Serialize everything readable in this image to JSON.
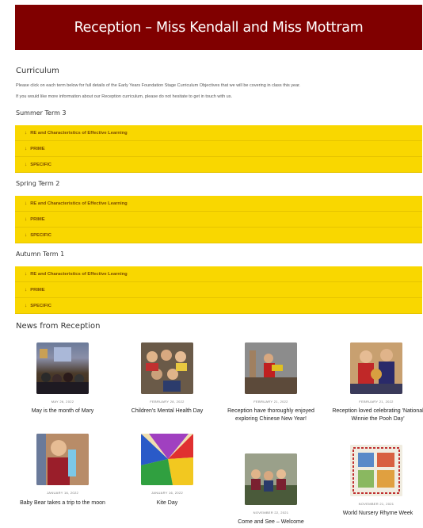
{
  "header": {
    "title": "Reception – Miss Kendall and Miss Mottram"
  },
  "curriculum": {
    "heading": "Curriculum",
    "intro_line1": "Please click on each term below for full details of the Early Years Foundation Stage Curriculum Objectives that we will be covering in class this year.",
    "intro_line2": "If you would like more information about our Reception curriculum, please do not hesitate to get in touch with us.",
    "terms": [
      {
        "title": "Summer Term 3",
        "items": [
          "RE and Characteristics of Effective Learning",
          "PRIME",
          "SPECIFIC"
        ]
      },
      {
        "title": "Spring Term 2",
        "items": [
          "RE and Characteristics of Effective Learning",
          "PRIME",
          "SPECIFIC"
        ]
      },
      {
        "title": "Autumn Term 1",
        "items": [
          "RE and Characteristics of Effective Learning",
          "PRIME",
          "SPECIFIC"
        ]
      }
    ],
    "arrow_icon": "arrow-down-icon"
  },
  "news": {
    "heading": "News from Reception",
    "posts": [
      {
        "date": "MAY 26, 2022",
        "title": "May is the month of Mary"
      },
      {
        "date": "FEBRUARY 28, 2022",
        "title": "Children's Mental Health Day"
      },
      {
        "date": "FEBRUARY 21, 2022",
        "title": "Reception have thoroughly enjoyed exploring Chinese New Year!"
      },
      {
        "date": "FEBRUARY 21, 2022",
        "title": "Reception loved celebrating 'National Winnie the Pooh Day'"
      },
      {
        "date": "JANUARY 16, 2022",
        "title": "Baby Bear takes a trip to the moon"
      },
      {
        "date": "JANUARY 16, 2022",
        "title": "Kite Day"
      },
      {
        "date": "NOVEMBER 22, 2021",
        "title": "Come and See – Welcome"
      },
      {
        "date": "NOVEMBER 21, 2021",
        "title": "World Nursery Rhyme Week"
      }
    ]
  },
  "colors": {
    "banner": "#800000",
    "accordion": "#f9d700",
    "accordion_text": "#7a4a00"
  }
}
